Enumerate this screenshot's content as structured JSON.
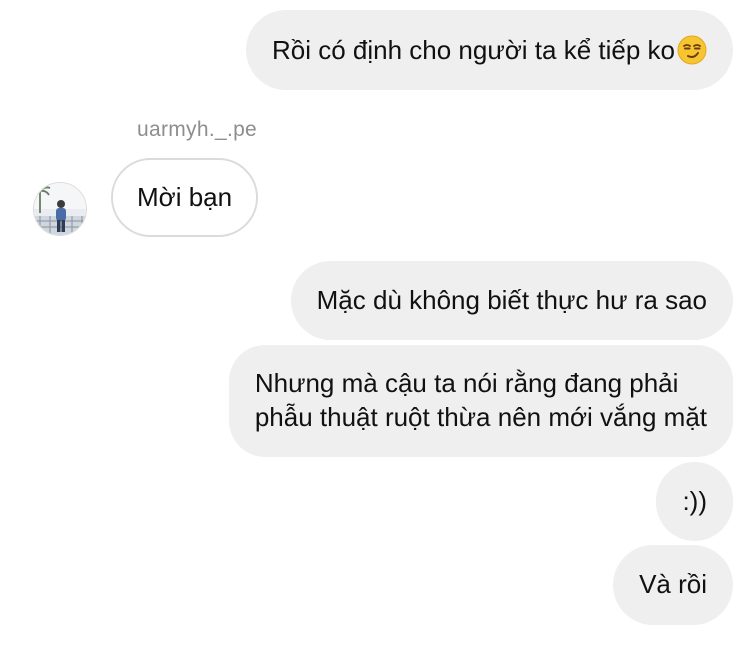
{
  "chat": {
    "messages": [
      {
        "direction": "outgoing",
        "text": "Rồi có định cho người ta kể tiếp ko",
        "emoji": "smirk-emoji"
      },
      {
        "direction": "incoming",
        "sender": "uarmyh._.pe",
        "text": "Mời bạn"
      },
      {
        "direction": "outgoing",
        "text": "Mặc dù không biết thực hư ra sao"
      },
      {
        "direction": "outgoing",
        "lines": [
          "Nhưng mà cậu ta nói rằng đang phải",
          "phẫu thuật ruột thừa nên mới vắng mặt"
        ]
      },
      {
        "direction": "outgoing",
        "text": ":))"
      },
      {
        "direction": "outgoing",
        "text": "Và rồi"
      }
    ]
  },
  "colors": {
    "outgoing_bubble": "#efefef",
    "incoming_border": "#dbdbdb",
    "sender_name": "#8e8e8e",
    "text": "#111111"
  }
}
